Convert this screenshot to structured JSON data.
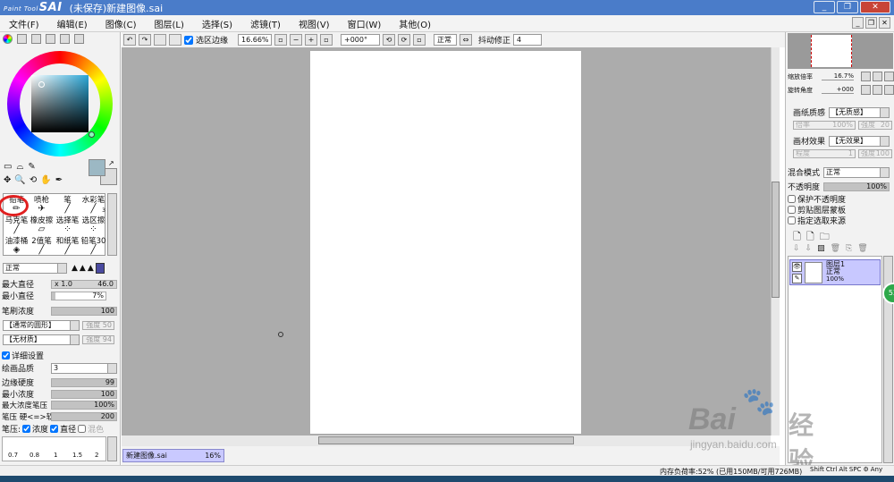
{
  "app": {
    "logo_small": "Paint Tool",
    "logo": "SAI",
    "title": "(未保存)新建图像.sai",
    "win_minimize": "_",
    "win_restore": "❐",
    "win_close": "✕"
  },
  "menu": [
    "文件(F)",
    "编辑(E)",
    "图像(C)",
    "图层(L)",
    "选择(S)",
    "滤镜(T)",
    "视图(V)",
    "窗口(W)",
    "其他(O)"
  ],
  "toolbar": {
    "selection_edge": "选区边缘",
    "zoom": "16.66%",
    "rotation": "+000°",
    "blend_mode": "正常",
    "stabilizer_label": "抖动修正",
    "stabilizer_value": "4"
  },
  "left": {
    "tools_row1": [
      "▭",
      "⌓",
      "✎"
    ],
    "tools_row2": [
      "✥",
      "🔍",
      "⟲",
      "✋",
      "✒"
    ],
    "brushes": [
      {
        "name": "铅笔",
        "size": ""
      },
      {
        "name": "喷枪",
        "size": ""
      },
      {
        "name": "笔",
        "size": ""
      },
      {
        "name": "水彩笔",
        "size": "3"
      },
      {
        "name": "马克笔",
        "size": ""
      },
      {
        "name": "橡皮擦",
        "size": ""
      },
      {
        "name": "选择笔",
        "size": ""
      },
      {
        "name": "选区擦",
        "size": ""
      },
      {
        "name": "油漆桶",
        "size": ""
      },
      {
        "name": "2值笔",
        "size": ""
      },
      {
        "name": "和纸笔",
        "size": ""
      },
      {
        "name": "铅笔30",
        "size": ""
      }
    ],
    "mode": "正常",
    "max_size_label": "最大直径",
    "max_size_mult": "x 1.0",
    "max_size_value": "46.0",
    "min_size_label": "最小直径",
    "min_size_value": "7%",
    "min_size_fraction": 0.07,
    "density_label": "笔刷浓度",
    "density_value": "100",
    "density_fraction": 1.0,
    "shape": "【通常的圆形】",
    "shape_strength": "强度 50",
    "texture": "【无材质】",
    "texture_strength": "强度 94",
    "detail_label": "详细设置",
    "quality_label": "绘画品质",
    "quality_value": "3",
    "edge_label": "边缘硬度",
    "edge_value": "99",
    "edge_fraction": 0.99,
    "min_density_label": "最小浓度",
    "min_density_value": "100",
    "min_density_fraction": 1.0,
    "max_pressure_label": "最大浓度笔压",
    "max_pressure_value": "100%",
    "max_pressure_fraction": 1.0,
    "pressure_hardness_label": "笔压 硬<=>软",
    "pressure_hardness_value": "200",
    "pressure_hardness_fraction": 1.0,
    "pressure_label": "笔压:",
    "pressure_density": "浓度",
    "pressure_size": "直径",
    "pressure_blend": "混色",
    "size_presets": [
      "0.7",
      "0.8",
      "1",
      "1.5",
      "2"
    ]
  },
  "right": {
    "zoom_label": "缩放倍率",
    "zoom_value": "16.7%",
    "angle_label": "旋转角度",
    "angle_value": "+000",
    "paper_texture_label": "画纸质感",
    "paper_texture_value": "【无质感】",
    "paper_scale_label": "倍率",
    "paper_scale_value": "100%",
    "paper_strength_label": "强度",
    "paper_strength_value": "20",
    "effect_label": "画材效果",
    "effect_value": "【无效果】",
    "effect_level_label": "程度",
    "effect_level_value": "1",
    "effect_strength_label": "强度",
    "effect_strength_value": "100",
    "blend_label": "混合模式",
    "blend_value": "正常",
    "opacity_label": "不透明度",
    "opacity_value": "100%",
    "opacity_fraction": 1.0,
    "protect_label": "保护不透明度",
    "clip_label": "剪贴图层蒙板",
    "source_label": "指定选取来源",
    "layer_name": "图层1",
    "layer_mode": "正常",
    "layer_opacity": "100%"
  },
  "tab": {
    "name": "新建图像.sai",
    "zoom": "16%"
  },
  "status": {
    "memory": "内存负荷率:52% (已用150MB/可用726MB)",
    "keys": [
      "Shift",
      "Ctrl",
      "Alt",
      "SPC"
    ],
    "any": "Any"
  },
  "watermark": {
    "brand": "Bai",
    "brand2": "经验",
    "url": "jingyan.baidu.com"
  },
  "colors": {
    "title": "#4a7cc9",
    "accent_circle": "#e02020",
    "layer_select": "#c8c8ff"
  }
}
